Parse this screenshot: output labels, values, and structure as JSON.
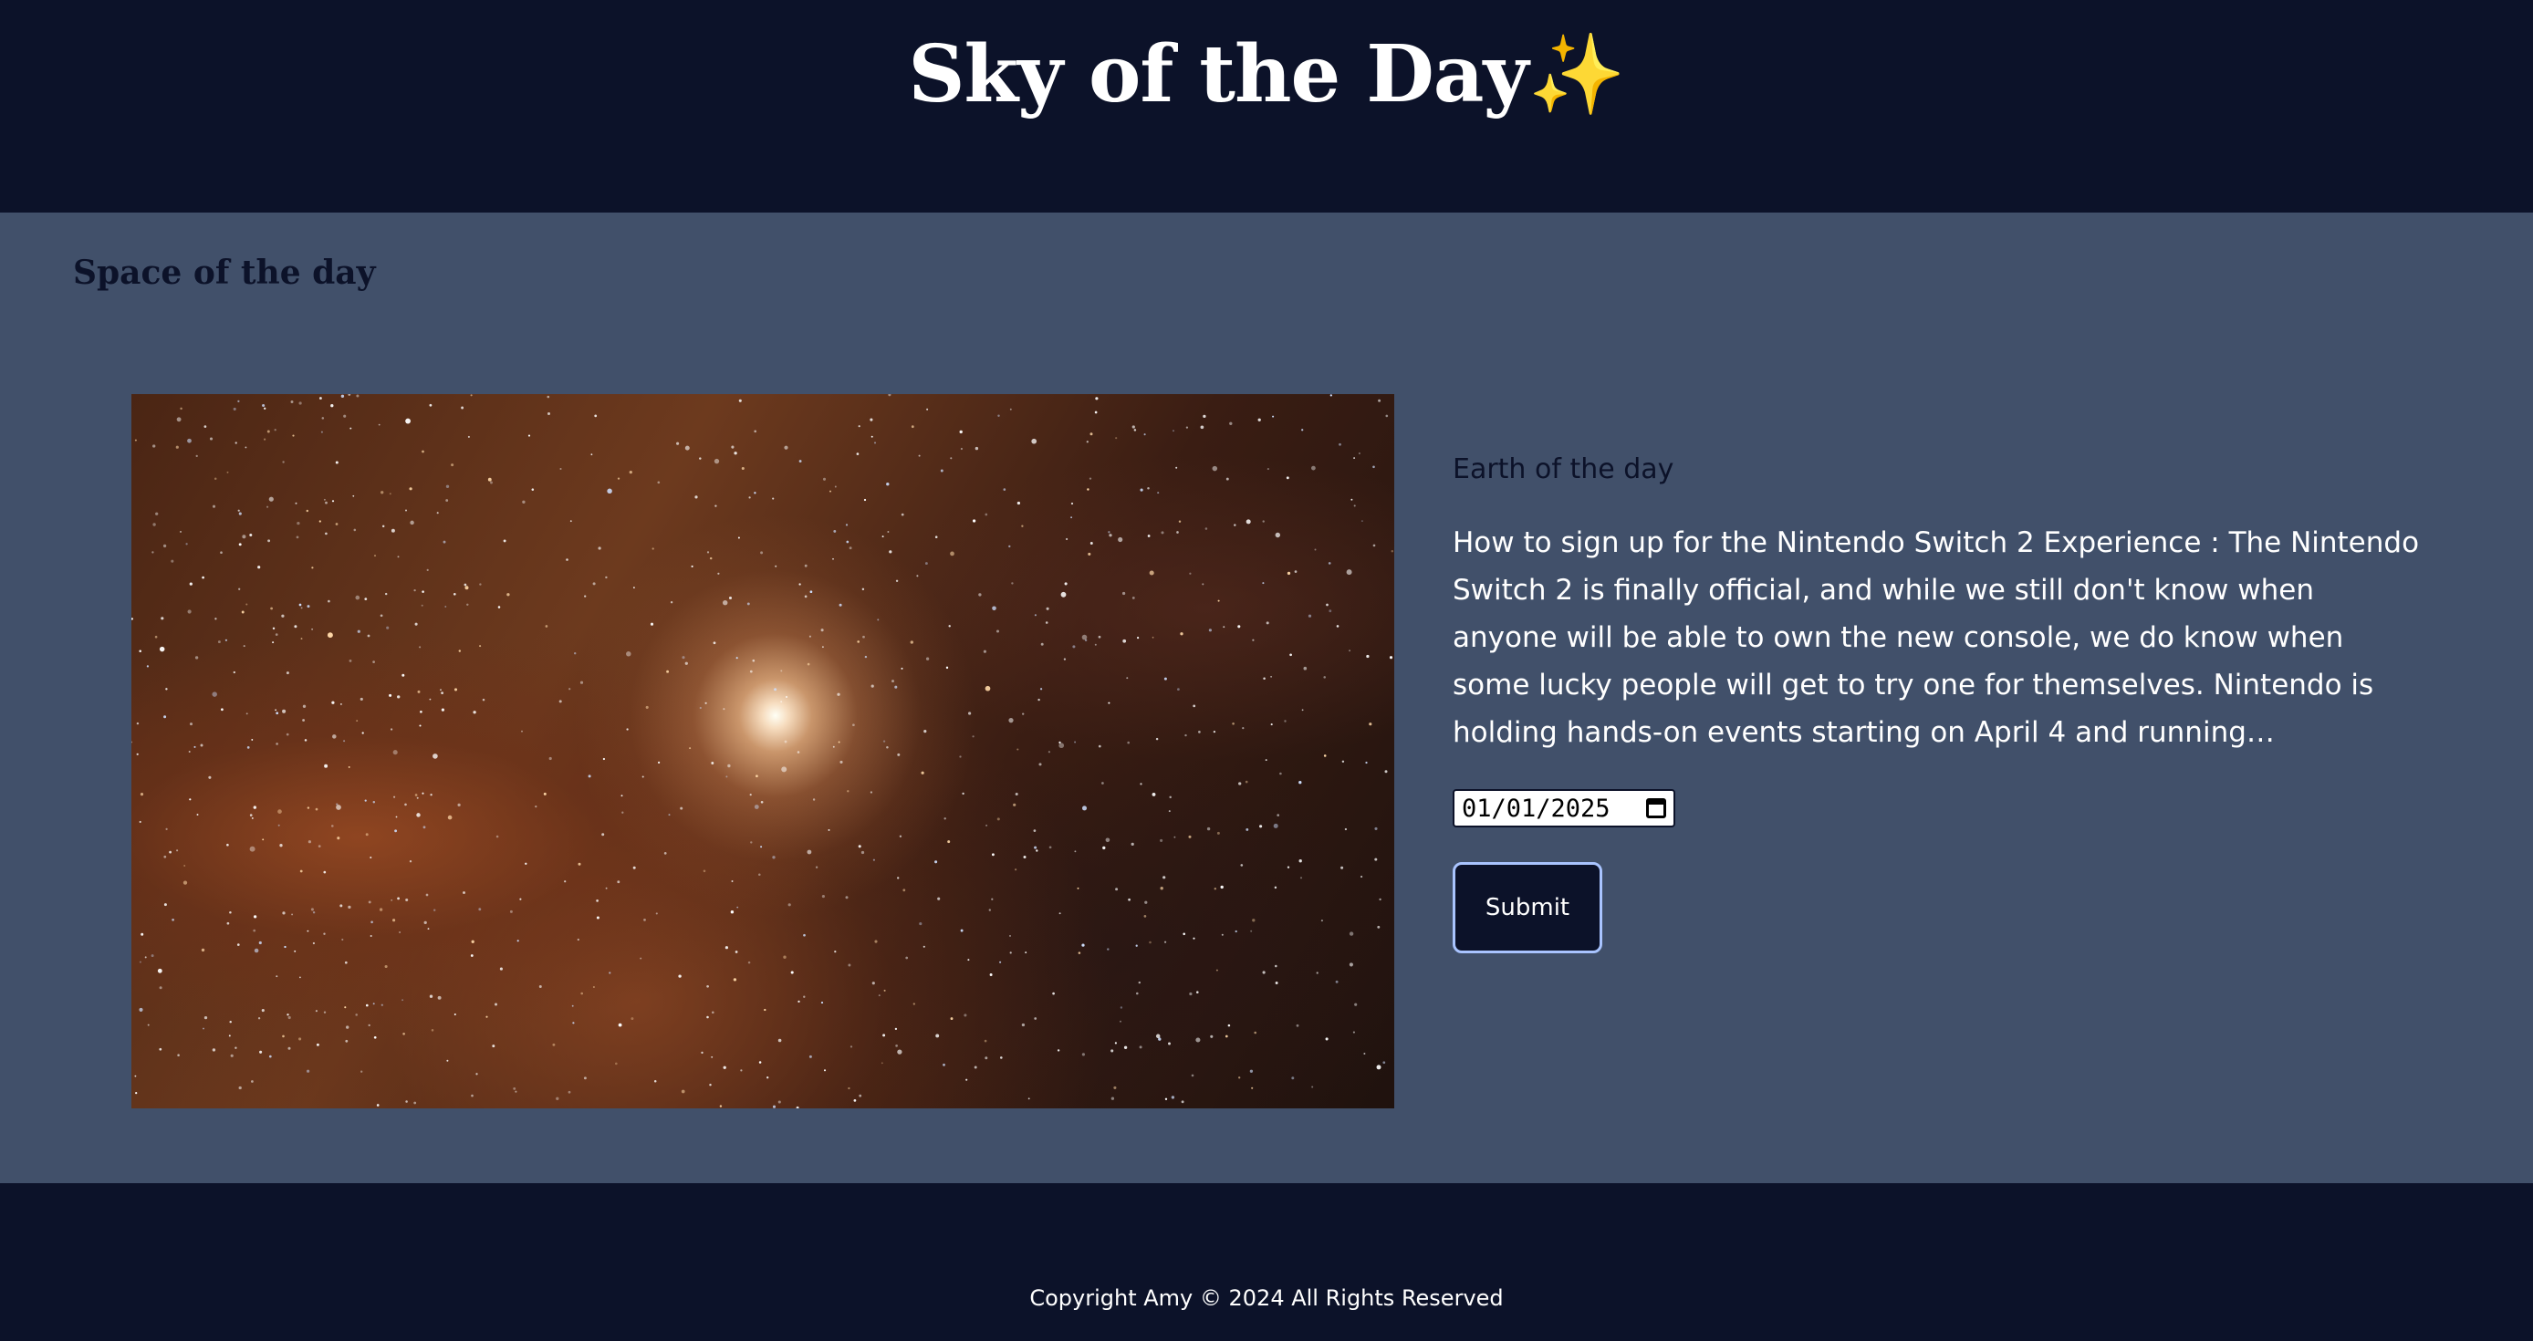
{
  "header": {
    "title": "Sky of the Day",
    "title_emoji": "✨"
  },
  "main": {
    "section_heading": "Space of the day",
    "image_icon": "space-photo",
    "details_title": "Earth of the day",
    "details_text": "How to sign up for the Nintendo Switch 2 Experience : The Nintendo Switch 2 is finally official, and while we still don't know when anyone will be able to own the new console, we do know when some lucky people will get to try one for themselves. Nintendo is holding hands-on events starting on April 4 and running…",
    "date_value": "01/01/2025",
    "submit_label": "Submit"
  },
  "footer": {
    "copyright": "Copyright Amy © 2024 All Rights Reserved"
  },
  "colors": {
    "header_bg": "#0c1229",
    "main_bg": "#41506a",
    "button_border": "#a9c4ff",
    "sparkle": "#f5c84c"
  }
}
